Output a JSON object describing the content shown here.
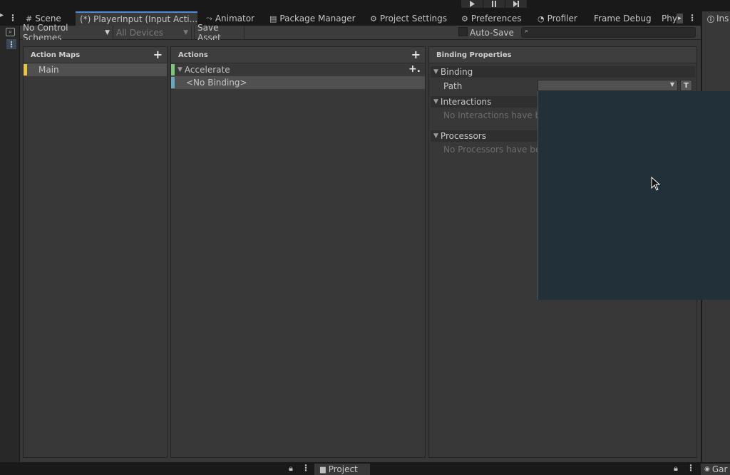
{
  "tabs": [
    {
      "icon": "grid-icon",
      "glyph": "#",
      "label": "Scene"
    },
    {
      "icon": "",
      "glyph": "",
      "label": "(*) PlayerInput (Input Acti...",
      "active": true
    },
    {
      "icon": "animator-icon",
      "glyph": "⤳",
      "label": "Animator"
    },
    {
      "icon": "package-icon",
      "glyph": "▤",
      "label": "Package Manager"
    },
    {
      "icon": "gear-icon",
      "glyph": "⚙",
      "label": "Project Settings"
    },
    {
      "icon": "gear-icon",
      "glyph": "⚙",
      "label": "Preferences"
    },
    {
      "icon": "profiler-icon",
      "glyph": "◔",
      "label": "Profiler"
    },
    {
      "icon": "",
      "glyph": "",
      "label": "Frame Debug"
    },
    {
      "icon": "",
      "glyph": "",
      "label": "Phy"
    }
  ],
  "right_tab_label": "Ins",
  "toolbar": {
    "control_scheme": "No Control Schemes",
    "devices": "All Devices",
    "save_asset": "Save Asset",
    "auto_save": "Auto-Save",
    "auto_save_checked": false
  },
  "action_maps": {
    "title": "Action Maps",
    "items": [
      {
        "label": "Main",
        "color": "#e8c34a",
        "selected": true
      }
    ]
  },
  "actions": {
    "title": "Actions",
    "action": {
      "label": "Accelerate",
      "color": "#7cc47a"
    },
    "binding": {
      "label": "<No Binding>",
      "color": "#6ba7b8"
    }
  },
  "binding_properties": {
    "title": "Binding Properties",
    "binding_section": "Binding",
    "path_label": "Path",
    "path_value": "",
    "t_button": "T",
    "interactions_section": "Interactions",
    "interactions_empty": "No Interactions have bee",
    "processors_section": "Processors",
    "processors_empty": "No Processors have bee"
  },
  "bottom": {
    "project_label": "Project",
    "game_label": "Gar"
  },
  "colors": {
    "popup_bg": "#223039",
    "accent": "#4e8ae0"
  }
}
